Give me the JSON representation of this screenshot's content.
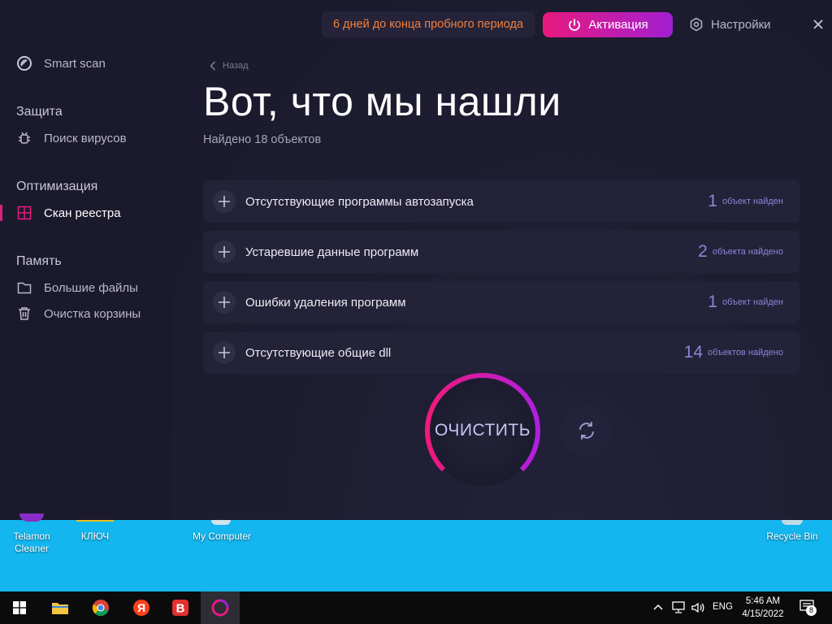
{
  "sidebar": {
    "smart_scan": "Smart scan",
    "sections": [
      {
        "title": "Защита",
        "items": [
          {
            "label": "Поиск вирусов",
            "icon": "bug-icon"
          }
        ]
      },
      {
        "title": "Оптимизация",
        "items": [
          {
            "label": "Скан реестра",
            "icon": "registry-icon",
            "active": true
          }
        ]
      },
      {
        "title": "Память",
        "items": [
          {
            "label": "Большие файлы",
            "icon": "folder-icon"
          },
          {
            "label": "Очистка корзины",
            "icon": "trash-icon"
          }
        ]
      }
    ]
  },
  "topbar": {
    "trial_text": "6 дней до конца пробного периода",
    "activate_label": "Активация",
    "settings_label": "Настройки"
  },
  "main": {
    "back_label": "Назад",
    "title": "Вот, что мы нашли",
    "subtitle": "Найдено 18 объектов",
    "results": [
      {
        "label": "Отсутствующие программы автозапуска",
        "count": "1",
        "count_text": "объект найден"
      },
      {
        "label": "Устаревшие данные программ",
        "count": "2",
        "count_text": "объекта найдено"
      },
      {
        "label": "Ошибки удаления программ",
        "count": "1",
        "count_text": "объект найден"
      },
      {
        "label": "Отсутствующие общие dll",
        "count": "14",
        "count_text": "объектов найдено"
      }
    ],
    "clean_label": "ОЧИСТИТЬ"
  },
  "desktop": {
    "icons": [
      {
        "label": "Telamon Cleaner"
      },
      {
        "label": "КЛЮЧ"
      },
      {
        "label": "My Computer"
      },
      {
        "label": "Recycle Bin"
      }
    ]
  },
  "taskbar": {
    "language": "ENG",
    "time": "5:46 AM",
    "date": "4/15/2022",
    "notification_count": "8"
  },
  "colors": {
    "accent_pink": "#e8197f",
    "accent_purple": "#a21fd2",
    "trial_orange": "#f0803a",
    "count_purple": "#8c86d8"
  }
}
